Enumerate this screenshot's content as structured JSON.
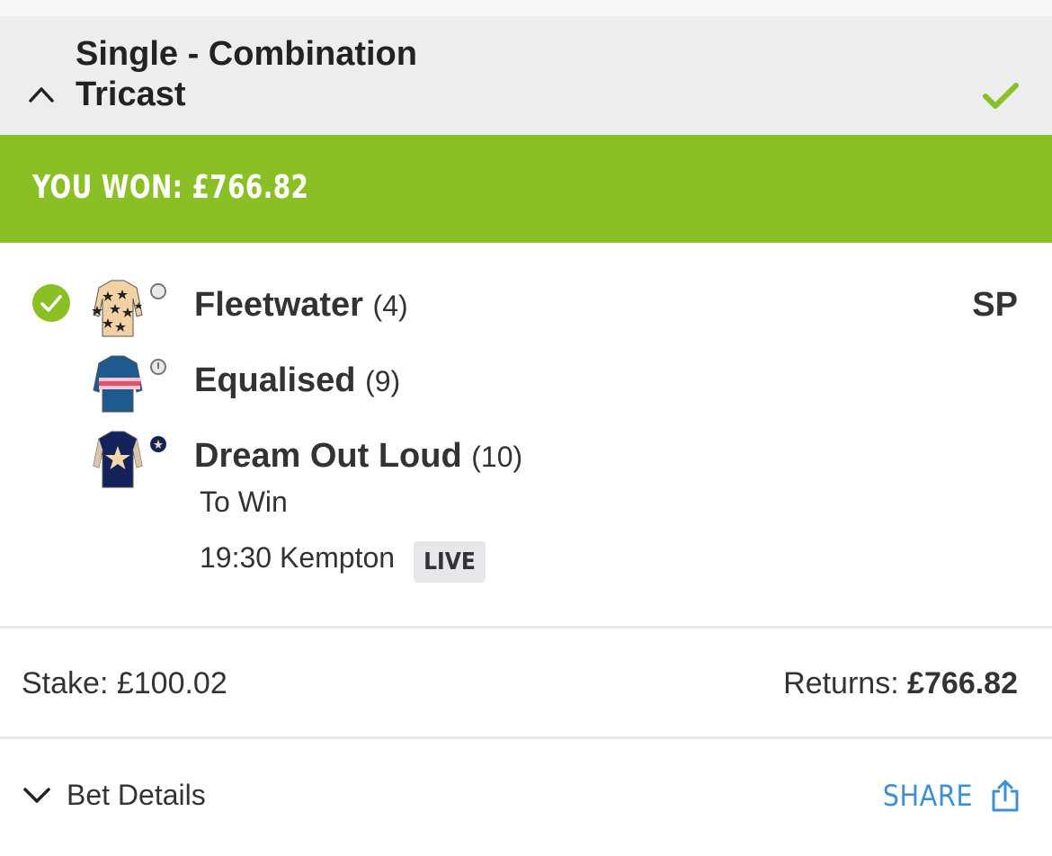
{
  "bet": {
    "title_line1": "Single - Combination",
    "title_line2": "Tricast",
    "banner": "YOU WON: £766.82",
    "status_color": "#8bbf26"
  },
  "selections": [
    {
      "name": "Fleetwater",
      "number": "(4)",
      "silk": "cream-black-stars"
    },
    {
      "name": "Equalised",
      "number": "(9)",
      "silk": "blue-pink-hoops"
    },
    {
      "name": "Dream Out Loud",
      "number": "(10)",
      "silk": "navy-gold-star"
    }
  ],
  "odds": "SP",
  "market": "To Win",
  "event": "19:30 Kempton",
  "live_label": "LIVE",
  "stake_label": "Stake:",
  "stake_value": "£100.02",
  "returns_label": "Returns:",
  "returns_value": "£766.82",
  "details_label": "Bet Details",
  "share_label": "SHARE",
  "colors": {
    "accent_green": "#8bbf26",
    "link_blue": "#3d8fd6",
    "header_bg": "#ededf0"
  }
}
